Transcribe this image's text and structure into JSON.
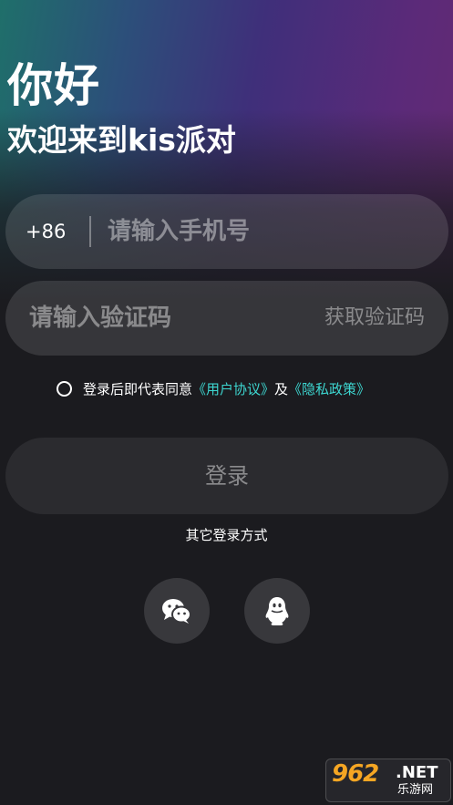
{
  "header": {
    "greeting": "你好",
    "welcome": "欢迎来到kis派对"
  },
  "phone": {
    "country_code": "+86",
    "placeholder": "请输入手机号",
    "value": ""
  },
  "code": {
    "placeholder": "请输入验证码",
    "value": "",
    "get_code_label": "获取验证码"
  },
  "agreement": {
    "checked": false,
    "prefix": "登录后即代表同意",
    "user_agreement": "《用户协议》",
    "and": "及",
    "privacy_policy": "《隐私政策》"
  },
  "login_button": "登录",
  "other_login": {
    "label": "其它登录方式",
    "methods": [
      {
        "icon": "wechat-icon"
      },
      {
        "icon": "qq-icon"
      }
    ]
  },
  "watermark": {
    "brand": "962",
    "domain": ".NET",
    "site": "乐游网"
  },
  "colors": {
    "link": "#3dd6d0",
    "background": "#1b1b1f",
    "input_bg": "#ffffff1f",
    "button_bg": "#2b2b2f"
  }
}
